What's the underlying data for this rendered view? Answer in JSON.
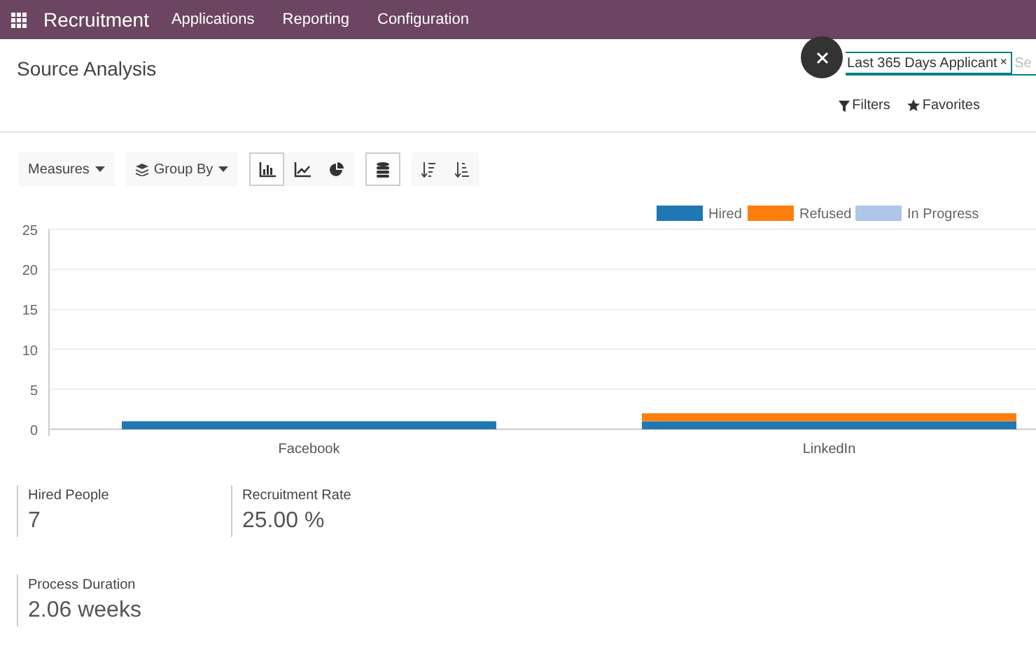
{
  "navbar": {
    "app_name": "Recruitment",
    "menu": [
      "Applications",
      "Reporting",
      "Configuration"
    ]
  },
  "page": {
    "title": "Source Analysis"
  },
  "search": {
    "facets": [
      {
        "label": "Last 365 Days Applicant",
        "remove": "×"
      }
    ],
    "placeholder": "Se"
  },
  "search_options": [
    "Filters",
    "Favorites"
  ],
  "toolbar": {
    "measures": "Measures",
    "group_by": "Group By",
    "chart_types": [
      {
        "kind": "bar",
        "selected": true
      },
      {
        "kind": "line",
        "selected": false
      },
      {
        "kind": "pie",
        "selected": false
      }
    ],
    "stacked": true
  },
  "chart": {
    "chart_data": {
      "type": "bar",
      "stacked": true,
      "grid": true,
      "legend": true,
      "categories": [
        "Facebook",
        "LinkedIn"
      ],
      "ylim": [
        0,
        25
      ],
      "yticks": [
        0,
        5,
        10,
        15,
        20,
        25
      ],
      "series": [
        {
          "name": "Hired",
          "color": "#1f77b4",
          "values": [
            1,
            1
          ]
        },
        {
          "name": "Refused",
          "color": "#ff7f0e",
          "values": [
            0,
            1
          ]
        },
        {
          "name": "In Progress",
          "color": "#aec7e8",
          "values": [
            0,
            0
          ]
        }
      ]
    }
  },
  "stats": [
    {
      "label": "Hired People",
      "value": "7"
    },
    {
      "label": "Recruitment Rate",
      "value": "25.00 %"
    },
    {
      "label": "Process Duration",
      "value": "2.06 weeks"
    }
  ]
}
